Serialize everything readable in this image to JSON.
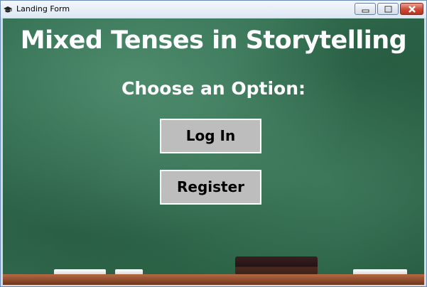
{
  "window": {
    "title": "Landing Form",
    "icon": "graduation-cap-icon",
    "controls": [
      "minimize-icon",
      "maximize-icon",
      "close-icon"
    ]
  },
  "main": {
    "title": "Mixed Tenses in Storytelling",
    "prompt": "Choose an Option:",
    "buttons": {
      "login": "Log In",
      "register": "Register"
    }
  },
  "colors": {
    "chalkboard": "#346f52",
    "button_bg": "#bdbdbd",
    "text": "#ffffff",
    "ledge": "#8a4a2b"
  }
}
